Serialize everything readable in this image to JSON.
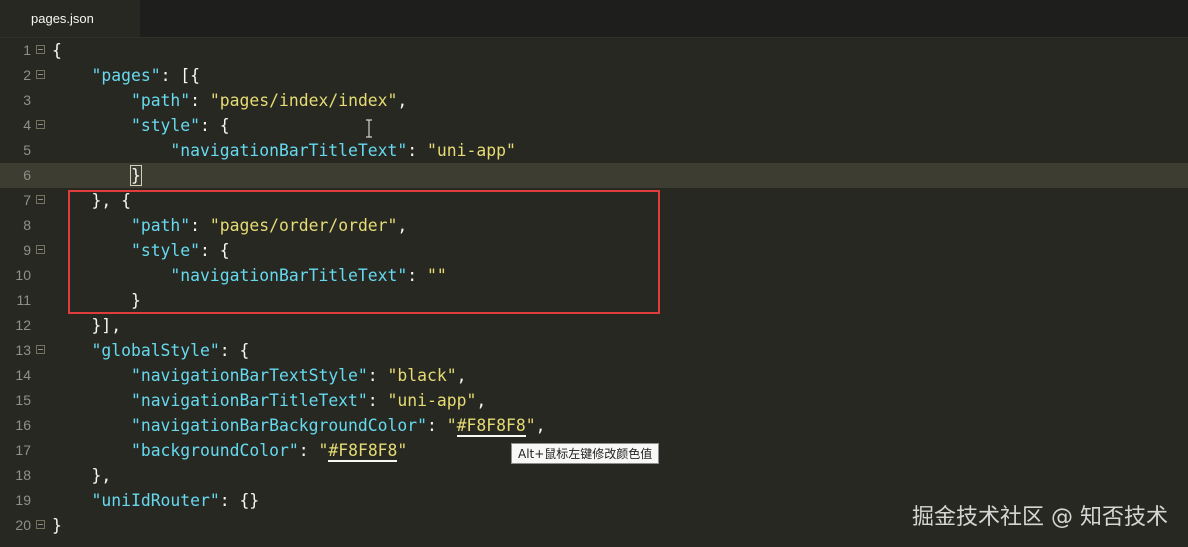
{
  "tab": {
    "filename": "pages.json"
  },
  "tooltip": "Alt+鼠标左键修改颜色值",
  "watermark": "掘金技术社区 @ 知否技术",
  "lines": [
    {
      "num": "1"
    },
    {
      "num": "2"
    },
    {
      "num": "3"
    },
    {
      "num": "4"
    },
    {
      "num": "5"
    },
    {
      "num": "6"
    },
    {
      "num": "7"
    },
    {
      "num": "8"
    },
    {
      "num": "9"
    },
    {
      "num": "10"
    },
    {
      "num": "11"
    },
    {
      "num": "12"
    },
    {
      "num": "13"
    },
    {
      "num": "14"
    },
    {
      "num": "15"
    },
    {
      "num": "16"
    },
    {
      "num": "17"
    },
    {
      "num": "18"
    },
    {
      "num": "19"
    },
    {
      "num": "20"
    }
  ],
  "code": {
    "l1": "{",
    "l2_key": "\"pages\"",
    "l2_rest": ": [{",
    "l3_key": "\"path\"",
    "l3_val": "\"pages/index/index\"",
    "l4_key": "\"style\"",
    "l4_rest": ": {",
    "l5_key": "\"navigationBarTitleText\"",
    "l5_val": "\"uni-app\"",
    "l6": "}",
    "l7": "}, {",
    "l8_key": "\"path\"",
    "l8_val": "\"pages/order/order\"",
    "l9_key": "\"style\"",
    "l9_rest": ": {",
    "l10_key": "\"navigationBarTitleText\"",
    "l10_val": "\"\"",
    "l11": "}",
    "l12": "}],",
    "l13_key": "\"globalStyle\"",
    "l13_rest": ": {",
    "l14_key": "\"navigationBarTextStyle\"",
    "l14_val": "\"black\"",
    "l15_key": "\"navigationBarTitleText\"",
    "l15_val": "\"uni-app\"",
    "l16_key": "\"navigationBarBackgroundColor\"",
    "l16_q": "\"",
    "l16_color": "#F8F8F8",
    "l17_key": "\"backgroundColor\"",
    "l17_q": "\"",
    "l17_color": "#F8F8F8",
    "l18": "},",
    "l19_key": "\"uniIdRouter\"",
    "l19_rest": ": {}",
    "l20": "}"
  },
  "colors": {
    "background": "#272822",
    "key": "#66d9ef",
    "string": "#e6db74",
    "highlight_border": "#e03c3c"
  }
}
